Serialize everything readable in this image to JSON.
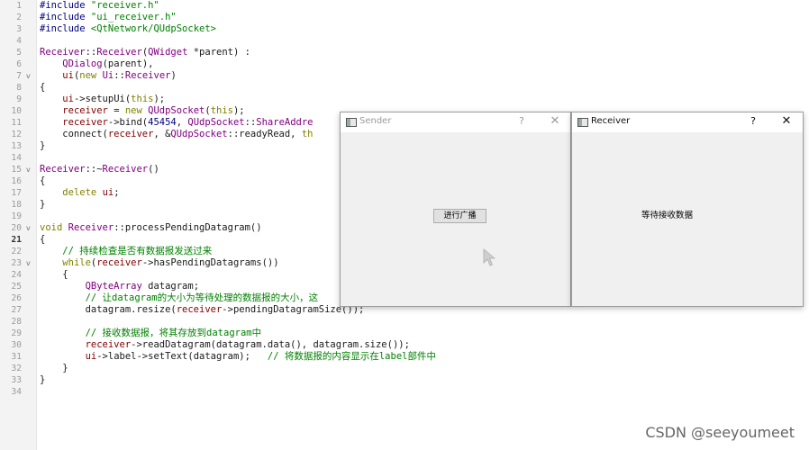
{
  "editor": {
    "current_line": 21,
    "lines": [
      {
        "n": "1",
        "fold": "",
        "tokens": [
          {
            "t": "#include ",
            "c": "pp"
          },
          {
            "t": "\"receiver.h\"",
            "c": "str"
          }
        ]
      },
      {
        "n": "2",
        "fold": "",
        "tokens": [
          {
            "t": "#include ",
            "c": "pp"
          },
          {
            "t": "\"ui_receiver.h\"",
            "c": "str"
          }
        ]
      },
      {
        "n": "3",
        "fold": "",
        "tokens": [
          {
            "t": "#include ",
            "c": "pp"
          },
          {
            "t": "<QtNetwork/QUdpSocket>",
            "c": "str"
          }
        ]
      },
      {
        "n": "4",
        "fold": "",
        "tokens": []
      },
      {
        "n": "5",
        "fold": "",
        "tokens": [
          {
            "t": "Receiver",
            "c": "cls"
          },
          {
            "t": "::",
            "c": ""
          },
          {
            "t": "Receiver",
            "c": "cls"
          },
          {
            "t": "(",
            "c": ""
          },
          {
            "t": "QWidget",
            "c": "cls"
          },
          {
            "t": " *parent) :",
            "c": ""
          }
        ]
      },
      {
        "n": "6",
        "fold": "",
        "tokens": [
          {
            "t": "    ",
            "c": ""
          },
          {
            "t": "QDialog",
            "c": "cls"
          },
          {
            "t": "(parent),",
            "c": ""
          }
        ]
      },
      {
        "n": "7",
        "fold": "v",
        "tokens": [
          {
            "t": "    ",
            "c": ""
          },
          {
            "t": "ui",
            "c": "pt"
          },
          {
            "t": "(",
            "c": ""
          },
          {
            "t": "new",
            "c": "kw"
          },
          {
            "t": " ",
            "c": ""
          },
          {
            "t": "Ui",
            "c": "cls"
          },
          {
            "t": "::",
            "c": ""
          },
          {
            "t": "Receiver",
            "c": "cls"
          },
          {
            "t": ")",
            "c": ""
          }
        ]
      },
      {
        "n": "8",
        "fold": "",
        "tokens": [
          {
            "t": "{",
            "c": ""
          }
        ]
      },
      {
        "n": "9",
        "fold": "",
        "tokens": [
          {
            "t": "    ",
            "c": ""
          },
          {
            "t": "ui",
            "c": "pt"
          },
          {
            "t": "->setupUi(",
            "c": ""
          },
          {
            "t": "this",
            "c": "kw"
          },
          {
            "t": ");",
            "c": ""
          }
        ]
      },
      {
        "n": "10",
        "fold": "",
        "tokens": [
          {
            "t": "    ",
            "c": ""
          },
          {
            "t": "receiver",
            "c": "pt"
          },
          {
            "t": " = ",
            "c": ""
          },
          {
            "t": "new",
            "c": "kw"
          },
          {
            "t": " ",
            "c": ""
          },
          {
            "t": "QUdpSocket",
            "c": "cls"
          },
          {
            "t": "(",
            "c": ""
          },
          {
            "t": "this",
            "c": "kw"
          },
          {
            "t": ");",
            "c": ""
          }
        ]
      },
      {
        "n": "11",
        "fold": "",
        "tokens": [
          {
            "t": "    ",
            "c": ""
          },
          {
            "t": "receiver",
            "c": "pt"
          },
          {
            "t": "->bind(",
            "c": ""
          },
          {
            "t": "45454",
            "c": "num"
          },
          {
            "t": ", ",
            "c": ""
          },
          {
            "t": "QUdpSocket",
            "c": "cls"
          },
          {
            "t": "::",
            "c": ""
          },
          {
            "t": "ShareAddre",
            "c": "cls"
          }
        ]
      },
      {
        "n": "12",
        "fold": "",
        "tokens": [
          {
            "t": "    connect(",
            "c": ""
          },
          {
            "t": "receiver",
            "c": "pt"
          },
          {
            "t": ", &",
            "c": ""
          },
          {
            "t": "QUdpSocket",
            "c": "cls"
          },
          {
            "t": "::readyRead, ",
            "c": ""
          },
          {
            "t": "th",
            "c": "kw"
          }
        ]
      },
      {
        "n": "13",
        "fold": "",
        "tokens": [
          {
            "t": "}",
            "c": ""
          }
        ]
      },
      {
        "n": "14",
        "fold": "",
        "tokens": []
      },
      {
        "n": "15",
        "fold": "v",
        "tokens": [
          {
            "t": "Receiver",
            "c": "cls"
          },
          {
            "t": "::~",
            "c": ""
          },
          {
            "t": "Receiver",
            "c": "cls"
          },
          {
            "t": "()",
            "c": ""
          }
        ]
      },
      {
        "n": "16",
        "fold": "",
        "tokens": [
          {
            "t": "{",
            "c": ""
          }
        ]
      },
      {
        "n": "17",
        "fold": "",
        "tokens": [
          {
            "t": "    ",
            "c": ""
          },
          {
            "t": "delete",
            "c": "kw"
          },
          {
            "t": " ",
            "c": ""
          },
          {
            "t": "ui",
            "c": "pt"
          },
          {
            "t": ";",
            "c": ""
          }
        ]
      },
      {
        "n": "18",
        "fold": "",
        "tokens": [
          {
            "t": "}",
            "c": ""
          }
        ]
      },
      {
        "n": "19",
        "fold": "",
        "tokens": []
      },
      {
        "n": "20",
        "fold": "v",
        "tokens": [
          {
            "t": "void",
            "c": "kw"
          },
          {
            "t": " ",
            "c": ""
          },
          {
            "t": "Receiver",
            "c": "cls"
          },
          {
            "t": "::processPendingDatagram()",
            "c": ""
          }
        ]
      },
      {
        "n": "21",
        "fold": "",
        "tokens": [
          {
            "t": "{",
            "c": ""
          }
        ]
      },
      {
        "n": "22",
        "fold": "",
        "tokens": [
          {
            "t": "    ",
            "c": ""
          },
          {
            "t": "// 持续检查是否有数据报发送过来",
            "c": "cm"
          }
        ]
      },
      {
        "n": "23",
        "fold": "v",
        "tokens": [
          {
            "t": "    ",
            "c": ""
          },
          {
            "t": "while",
            "c": "kw"
          },
          {
            "t": "(",
            "c": ""
          },
          {
            "t": "receiver",
            "c": "pt"
          },
          {
            "t": "->hasPendingDatagrams())",
            "c": ""
          }
        ]
      },
      {
        "n": "24",
        "fold": "",
        "tokens": [
          {
            "t": "    {",
            "c": ""
          }
        ]
      },
      {
        "n": "25",
        "fold": "",
        "tokens": [
          {
            "t": "        ",
            "c": ""
          },
          {
            "t": "QByteArray",
            "c": "cls"
          },
          {
            "t": " datagram;",
            "c": ""
          }
        ]
      },
      {
        "n": "26",
        "fold": "",
        "tokens": [
          {
            "t": "        ",
            "c": ""
          },
          {
            "t": "// 让datagram的大小为等待处理的数据报的大小，这",
            "c": "cm"
          }
        ]
      },
      {
        "n": "27",
        "fold": "",
        "tokens": [
          {
            "t": "        datagram.resize(",
            "c": ""
          },
          {
            "t": "receiver",
            "c": "pt"
          },
          {
            "t": "->pendingDatagramSize());",
            "c": ""
          }
        ]
      },
      {
        "n": "28",
        "fold": "",
        "tokens": []
      },
      {
        "n": "29",
        "fold": "",
        "tokens": [
          {
            "t": "        ",
            "c": ""
          },
          {
            "t": "// 接收数据报，将其存放到datagram中",
            "c": "cm"
          }
        ]
      },
      {
        "n": "30",
        "fold": "",
        "tokens": [
          {
            "t": "        ",
            "c": ""
          },
          {
            "t": "receiver",
            "c": "pt"
          },
          {
            "t": "->readDatagram(datagram.data(), datagram.size());",
            "c": ""
          }
        ]
      },
      {
        "n": "31",
        "fold": "",
        "tokens": [
          {
            "t": "        ",
            "c": ""
          },
          {
            "t": "ui",
            "c": "pt"
          },
          {
            "t": "->label->setText(datagram);   ",
            "c": ""
          },
          {
            "t": "// 将数据报的内容显示在label部件中",
            "c": "cm"
          }
        ]
      },
      {
        "n": "32",
        "fold": "",
        "tokens": [
          {
            "t": "    }",
            "c": ""
          }
        ]
      },
      {
        "n": "33",
        "fold": "",
        "tokens": [
          {
            "t": "}",
            "c": ""
          }
        ]
      },
      {
        "n": "34",
        "fold": "",
        "tokens": []
      }
    ]
  },
  "sender_window": {
    "title": "Sender",
    "help_glyph": "?",
    "close_glyph": "✕",
    "broadcast_button_label": "进行广播"
  },
  "receiver_window": {
    "title": "Receiver",
    "help_glyph": "?",
    "close_glyph": "✕",
    "waiting_label": "等待接收数据"
  },
  "watermark": "CSDN @seeyoumeet"
}
